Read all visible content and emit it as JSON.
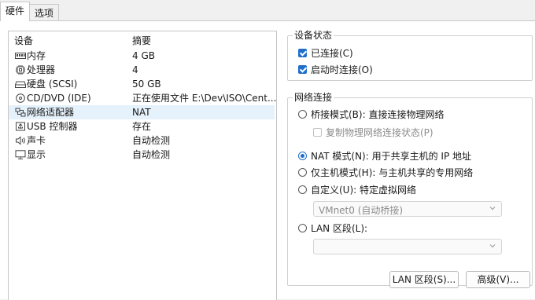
{
  "tabs": [
    "硬件",
    "选项"
  ],
  "device_table": {
    "headers": [
      "设备",
      "摘要"
    ],
    "rows": [
      {
        "icon": "memory-icon",
        "name": "内存",
        "summary": "4 GB"
      },
      {
        "icon": "processor-icon",
        "name": "处理器",
        "summary": "4"
      },
      {
        "icon": "hard-disk-icon",
        "name": "硬盘 (SCSI)",
        "summary": "50 GB"
      },
      {
        "icon": "cd-dvd-icon",
        "name": "CD/DVD (IDE)",
        "summary": "正在使用文件 E:\\Dev\\ISO\\Cent..."
      },
      {
        "icon": "network-adapter-icon",
        "name": "网络适配器",
        "summary": "NAT"
      },
      {
        "icon": "usb-controller-icon",
        "name": "USB 控制器",
        "summary": "存在"
      },
      {
        "icon": "sound-card-icon",
        "name": "声卡",
        "summary": "自动检测"
      },
      {
        "icon": "display-icon",
        "name": "显示",
        "summary": "自动检测"
      }
    ],
    "selected_index": 4
  },
  "device_status": {
    "title": "设备状态",
    "connected": {
      "label": "已连接(C)",
      "checked": true
    },
    "connect_at_power_on": {
      "label": "启动时连接(O)",
      "checked": true
    }
  },
  "network_connection": {
    "title": "网络连接",
    "bridged": {
      "label": "桥接模式(B): 直接连接物理网络",
      "selected": false
    },
    "replicate": {
      "label": "复制物理网络连接状态(P)",
      "checked": false,
      "enabled": false
    },
    "nat": {
      "label": "NAT 模式(N): 用于共享主机的 IP 地址",
      "selected": true
    },
    "host_only": {
      "label": "仅主机模式(H): 与主机共享的专用网络",
      "selected": false
    },
    "custom": {
      "label": "自定义(U): 特定虚拟网络",
      "selected": false
    },
    "custom_network_value": "VMnet0 (自动桥接)",
    "lan_segment": {
      "label": "LAN 区段(L):",
      "selected": false
    },
    "lan_segment_value": ""
  },
  "buttons": {
    "lan_segments": "LAN 区段(S)...",
    "advanced": "高级(V)..."
  },
  "colors": {
    "accent": "#1f6fc9",
    "selected_row": "#e5f1fb",
    "disabled_text": "#8c8c8c"
  }
}
